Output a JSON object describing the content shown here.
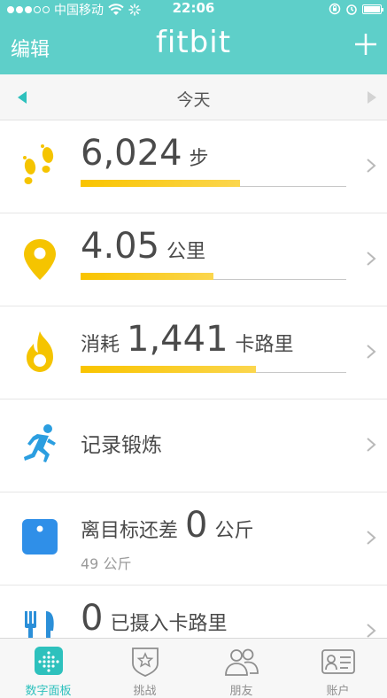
{
  "status_bar": {
    "carrier": "中国移动",
    "time": "22:06"
  },
  "nav": {
    "edit_label": "编辑",
    "title": "fitbit",
    "add_icon": "plus-icon"
  },
  "date_bar": {
    "label": "今天"
  },
  "tiles": [
    {
      "icon": "footsteps-icon",
      "value": "6,024",
      "unit": "步",
      "progress": 0.6
    },
    {
      "icon": "location-pin-icon",
      "value": "4.05",
      "unit": "公里",
      "progress": 0.5
    },
    {
      "icon": "flame-icon",
      "prefix": "消耗",
      "value": "1,441",
      "unit": "卡路里",
      "progress": 0.66
    },
    {
      "icon": "running-person-icon",
      "label": "记录锻炼"
    },
    {
      "icon": "scale-icon",
      "prefix": "离目标还差",
      "value": "0",
      "unit": "公斤",
      "sub": "49 公斤"
    },
    {
      "icon": "fork-knife-icon",
      "value": "0",
      "unit": "已摄入卡路里"
    }
  ],
  "tabs": [
    {
      "label": "数字面板",
      "icon": "dashboard-icon",
      "active": true
    },
    {
      "label": "挑战",
      "icon": "challenge-badge-icon",
      "active": false
    },
    {
      "label": "朋友",
      "icon": "friends-icon",
      "active": false
    },
    {
      "label": "账户",
      "icon": "account-card-icon",
      "active": false
    }
  ],
  "colors": {
    "header": "#5ecfc9",
    "accent": "#2ec1bd",
    "progress": "#f9c400",
    "workout_icon": "#2b9ee0",
    "scale_icon": "#2f8fe8",
    "food_icon": "#2b8fd8"
  }
}
